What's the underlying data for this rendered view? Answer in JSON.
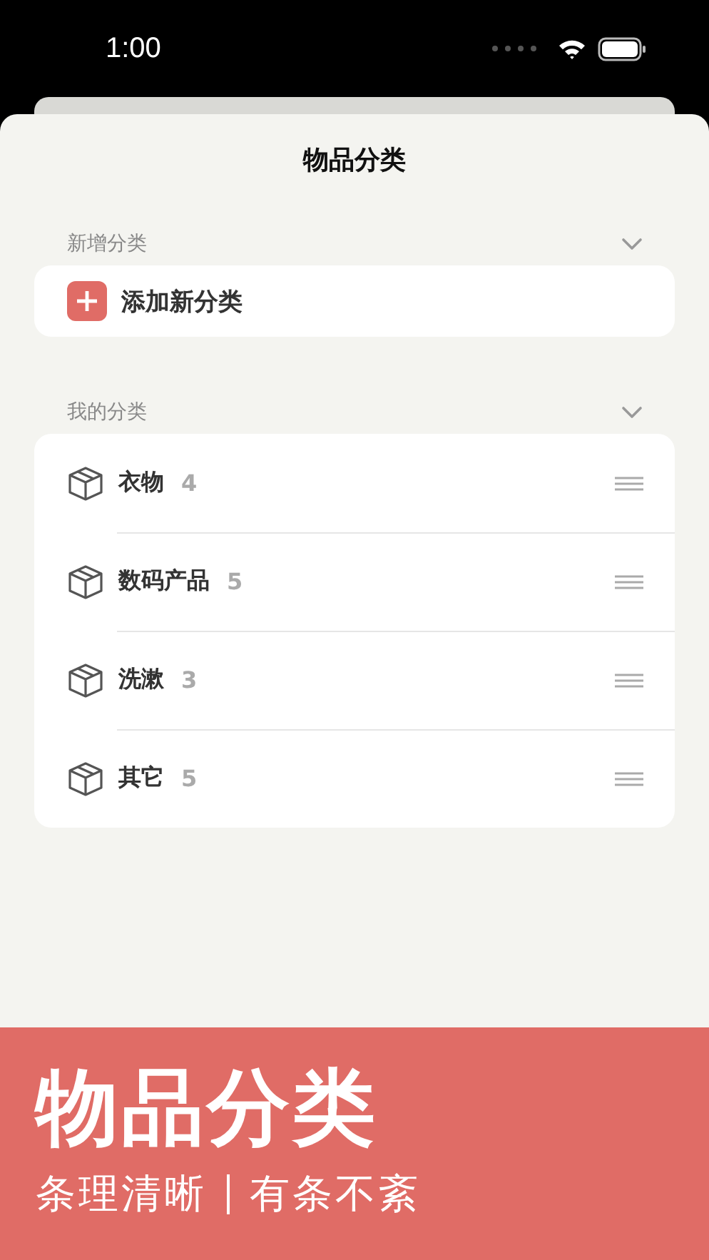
{
  "status_bar": {
    "time": "1:00"
  },
  "sheet": {
    "title": "物品分类"
  },
  "sections": [
    {
      "kind": "add",
      "header": "新增分类",
      "expanded": true,
      "action": "添加新分类"
    },
    {
      "kind": "list",
      "header": "我的分类",
      "expanded": true,
      "items": [
        {
          "name": "衣物",
          "count": "4"
        },
        {
          "name": "数码产品",
          "count": "5"
        },
        {
          "name": "洗漱",
          "count": "3"
        },
        {
          "name": "其它",
          "count": "5"
        }
      ]
    }
  ],
  "banner": {
    "title": "物品分类",
    "taglines": [
      "条理清晰",
      "有条不紊"
    ]
  }
}
